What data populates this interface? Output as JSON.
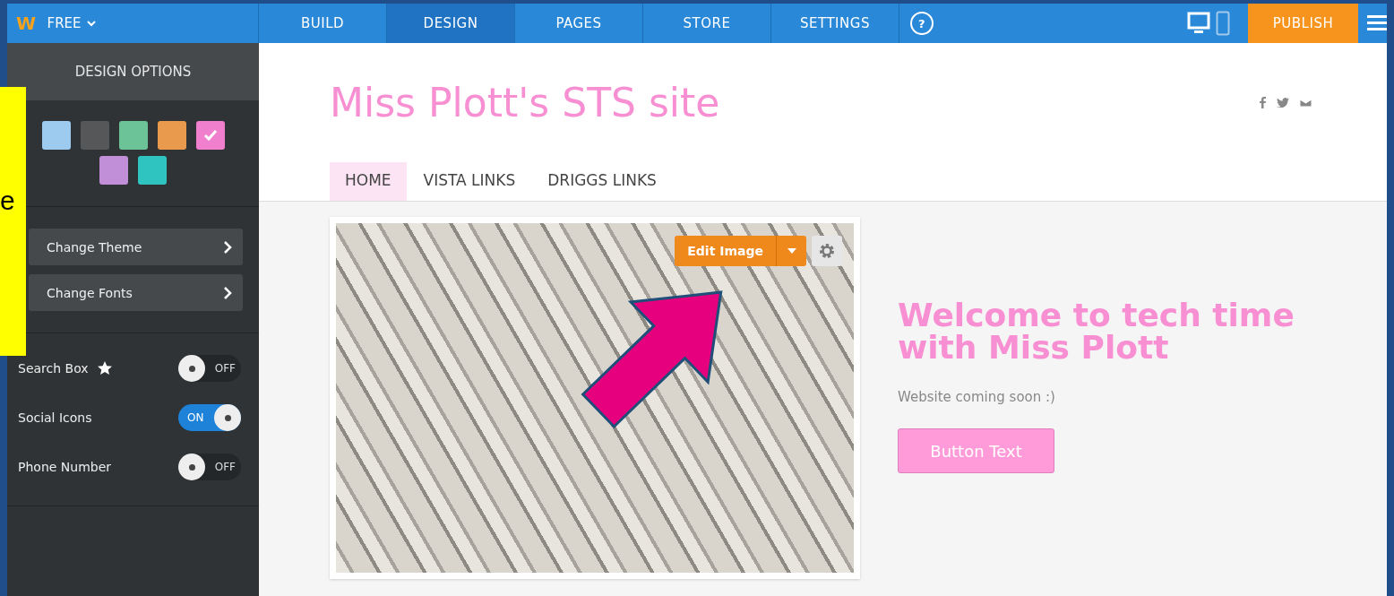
{
  "topbar": {
    "logo": "W",
    "plan": "FREE",
    "tabs": [
      {
        "label": "BUILD",
        "selected": false
      },
      {
        "label": "DESIGN",
        "selected": true
      },
      {
        "label": "PAGES",
        "selected": false
      },
      {
        "label": "STORE",
        "selected": false
      },
      {
        "label": "SETTINGS",
        "selected": false
      }
    ],
    "help": "?",
    "devices": [
      {
        "kind": "desktop",
        "selected": true
      },
      {
        "kind": "mobile",
        "selected": false
      }
    ],
    "publish": "PUBLISH"
  },
  "sidebar": {
    "title": "DESIGN OPTIONS",
    "swatches": [
      {
        "color": "#9dcbf0",
        "selected": false
      },
      {
        "color": "#555759",
        "selected": false
      },
      {
        "color": "#6cc397",
        "selected": false
      },
      {
        "color": "#e99a4c",
        "selected": false
      },
      {
        "color": "#f07fcd",
        "selected": true
      },
      {
        "color": "#c08fd8",
        "selected": false
      },
      {
        "color": "#30c4c0",
        "selected": false
      }
    ],
    "menu": [
      "Change Theme",
      "Change Fonts"
    ],
    "toggles": [
      {
        "label": "Search Box",
        "starred": true,
        "on": false,
        "state_label": "OFF"
      },
      {
        "label": "Social Icons",
        "starred": false,
        "on": true,
        "state_label": "ON"
      },
      {
        "label": "Phone Number",
        "starred": false,
        "on": false,
        "state_label": "OFF"
      }
    ]
  },
  "site": {
    "title": "Miss Plott's STS site",
    "nav": [
      {
        "label": "HOME",
        "selected": true
      },
      {
        "label": "VISTA LINKS",
        "selected": false
      },
      {
        "label": "DRIGGS LINKS",
        "selected": false
      }
    ],
    "edit_image": "Edit Image",
    "heading": "Welcome to tech time with Miss Plott",
    "text": "Website coming soon :)",
    "button": "Button Text"
  },
  "note": {
    "text": "e"
  }
}
